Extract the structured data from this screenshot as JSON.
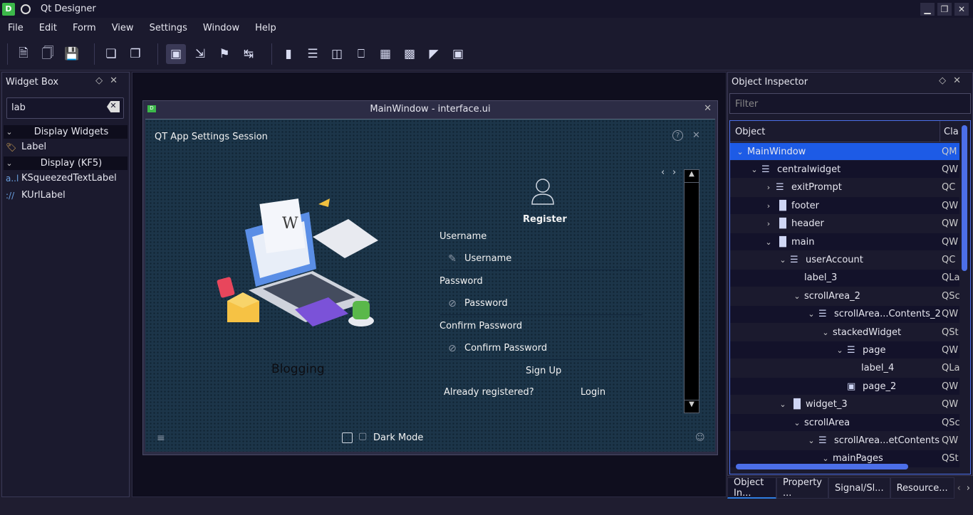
{
  "app": {
    "title": "Qt Designer",
    "icon_letter": "D"
  },
  "window_controls": [
    "minimize-icon",
    "maximize-icon",
    "close-icon"
  ],
  "menu": [
    "File",
    "Edit",
    "Form",
    "View",
    "Settings",
    "Window",
    "Help"
  ],
  "toolbar_icons": [
    "new-form-icon",
    "open-form-icon",
    "save-form-icon",
    "send-to-back-icon",
    "bring-to-front-icon",
    "edit-widgets-icon",
    "edit-signals-slots-icon",
    "edit-buddies-icon",
    "edit-tab-order-icon",
    "layout-horizontal-icon",
    "layout-vertical-icon",
    "layout-horizontal-splitter-icon",
    "layout-vertical-splitter-icon",
    "layout-grid-icon",
    "layout-form-icon",
    "break-layout-icon",
    "adjust-size-icon"
  ],
  "widget_box": {
    "title": "Widget Box",
    "search_value": "lab",
    "categories": [
      {
        "label": "Display Widgets",
        "items": [
          {
            "label": "Label",
            "icon": "label-tag-icon"
          }
        ]
      },
      {
        "label": "Display (KF5)",
        "items": [
          {
            "label": "KSqueezedTextLabel",
            "icon": "squeezed-text-icon"
          },
          {
            "label": "KUrlLabel",
            "icon": "url-label-icon"
          }
        ]
      }
    ]
  },
  "form_window": {
    "title": "MainWindow - interface.ui",
    "header_title": "QT App Settings Session",
    "illustration_caption": "Blogging",
    "register_title": "Register",
    "username_label": "Username",
    "username_placeholder": "Username",
    "password_label": "Password",
    "password_placeholder": "Password",
    "confirm_label": "Confirm Password",
    "confirm_placeholder": "Confirm Password",
    "signup_button": "Sign Up",
    "already_registered": "Already registered?",
    "login_button": "Login",
    "dark_mode_label": "Dark Mode",
    "dark_mode_checked": false
  },
  "object_inspector": {
    "title": "Object Inspector",
    "filter_placeholder": "Filter",
    "col_object": "Object",
    "col_class": "Cla",
    "rows": [
      {
        "name": "MainWindow",
        "cls": "QM",
        "depth": 0,
        "icon": "",
        "twisty": "open"
      },
      {
        "name": "centralwidget",
        "cls": "QW",
        "depth": 1,
        "icon": "vbox-icon",
        "twisty": "open"
      },
      {
        "name": "exitPrompt",
        "cls": "QC",
        "depth": 2,
        "icon": "vbox-icon",
        "twisty": "closed"
      },
      {
        "name": "footer",
        "cls": "QW",
        "depth": 2,
        "icon": "hbox-icon",
        "twisty": "closed"
      },
      {
        "name": "header",
        "cls": "QW",
        "depth": 2,
        "icon": "hbox-icon",
        "twisty": "closed"
      },
      {
        "name": "main",
        "cls": "QW",
        "depth": 2,
        "icon": "hbox-icon",
        "twisty": "open"
      },
      {
        "name": "userAccount",
        "cls": "QC",
        "depth": 3,
        "icon": "vbox-icon",
        "twisty": "open"
      },
      {
        "name": "label_3",
        "cls": "QLa",
        "depth": 4,
        "icon": "",
        "twisty": ""
      },
      {
        "name": "scrollArea_2",
        "cls": "QSc",
        "depth": 4,
        "icon": "",
        "twisty": "open"
      },
      {
        "name": "scrollArea...Contents_2",
        "cls": "QW",
        "depth": 5,
        "icon": "vbox-icon",
        "twisty": "open"
      },
      {
        "name": "stackedWidget",
        "cls": "QSt",
        "depth": 6,
        "icon": "",
        "twisty": "open"
      },
      {
        "name": "page",
        "cls": "QW",
        "depth": 7,
        "icon": "vbox-icon",
        "twisty": "open"
      },
      {
        "name": "label_4",
        "cls": "QLa",
        "depth": 8,
        "icon": "",
        "twisty": ""
      },
      {
        "name": "page_2",
        "cls": "QW",
        "depth": 7,
        "icon": "break-layout-icon",
        "twisty": ""
      },
      {
        "name": "widget_3",
        "cls": "QW",
        "depth": 3,
        "icon": "hbox-icon",
        "twisty": "open"
      },
      {
        "name": "scrollArea",
        "cls": "QSc",
        "depth": 4,
        "icon": "",
        "twisty": "open"
      },
      {
        "name": "scrollArea...etContents",
        "cls": "QW",
        "depth": 5,
        "icon": "vbox-icon",
        "twisty": "open"
      },
      {
        "name": "mainPages",
        "cls": "QSt",
        "depth": 6,
        "icon": "",
        "twisty": "open"
      }
    ]
  },
  "bottom_tabs": [
    "Object In...",
    "Property ...",
    "Signal/Sl...",
    "Resource..."
  ],
  "colors": {
    "accent": "#1d5be6",
    "form_bg": "#1c3549",
    "panel_bg": "#1b1a2e"
  }
}
